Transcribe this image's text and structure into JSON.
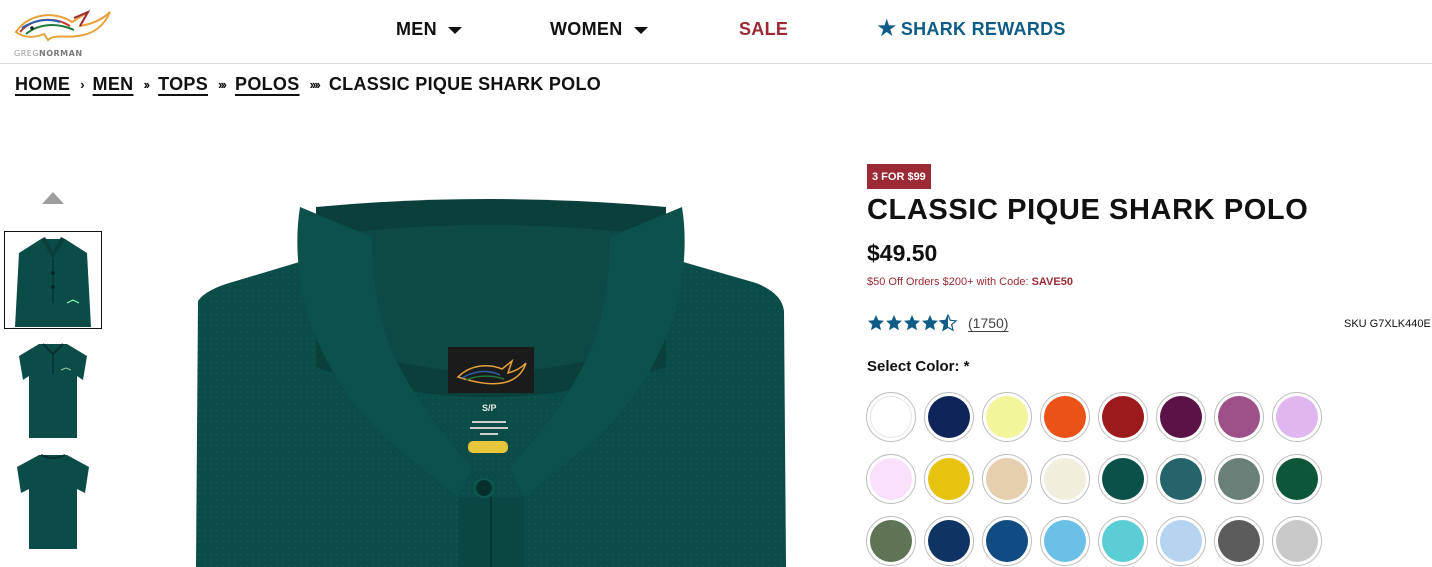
{
  "header": {
    "logo_text_light": "GREG",
    "logo_text_bold": "NORMAN",
    "nav": {
      "men": "MEN",
      "women": "WOMEN",
      "sale": "SALE",
      "rewards": "SHARK REWARDS"
    },
    "icons": {
      "rewards": "star-icon",
      "dropdown": "caret-down-icon"
    }
  },
  "breadcrumb": {
    "items": [
      "HOME",
      "MEN",
      "TOPS",
      "POLOS"
    ],
    "separators": [
      "›",
      "››",
      "›››",
      "››››"
    ],
    "current": "CLASSIC PIQUE SHARK POLO"
  },
  "gallery": {
    "thumbnail_count": 3,
    "active_index": 0
  },
  "product": {
    "badge": "3 FOR $99",
    "title": "CLASSIC PIQUE SHARK POLO",
    "price": "$49.50",
    "promo_text": "$50 Off Orders $200+ with Code: ",
    "promo_code": "SAVE50",
    "rating": 4.5,
    "rating_count": "(1750)",
    "sku": "SKU G7XLK440E",
    "color_label": "Select Color: *",
    "garment_label_size": "S/P",
    "colors": {
      "accent_red": "#9b2a35",
      "accent_blue": "#0f5c86",
      "garment": "#0b4c48"
    }
  },
  "swatches": [
    "#ffffff",
    "#0f2458",
    "#f2f59a",
    "#ea5218",
    "#9c1a1c",
    "#5a1247",
    "#9e5088",
    "#e0b6ee",
    "#fbe0fb",
    "#e6c30f",
    "#e5cfae",
    "#f1eede",
    "#0a5249",
    "#24646a",
    "#6a7f78",
    "#0d5638",
    "#5f7455",
    "#0f3362",
    "#104b82",
    "#6ac0e6",
    "#5acdd5",
    "#b4d4f0",
    "#5c5c5c",
    "#c9c9c9"
  ]
}
